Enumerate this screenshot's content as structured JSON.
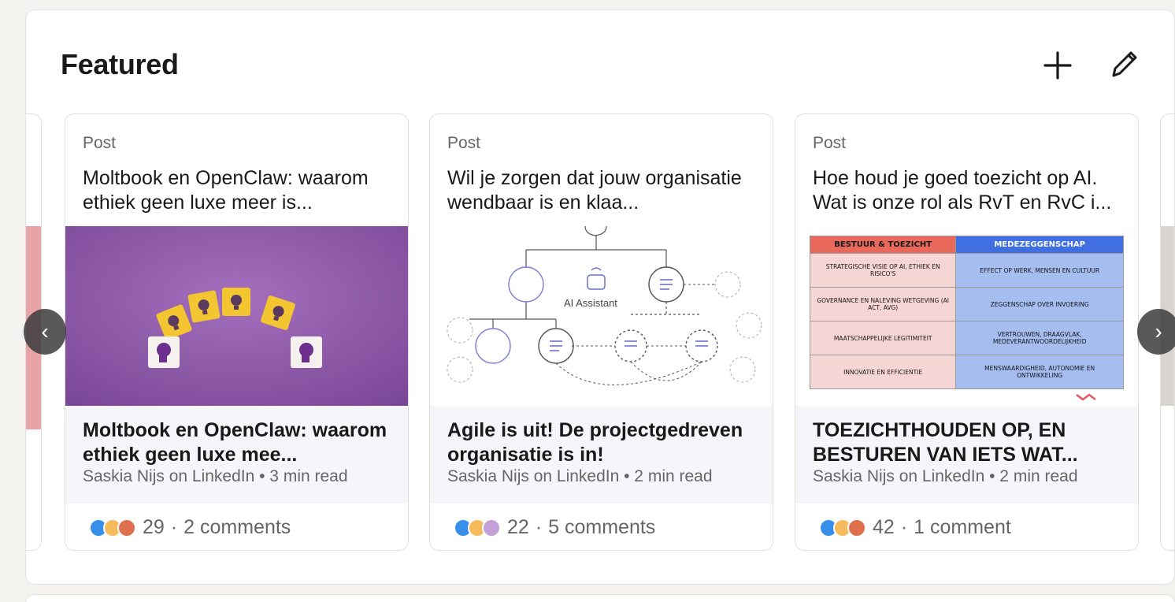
{
  "section": {
    "title": "Featured"
  },
  "header_actions": {
    "add_icon": "plus-icon",
    "edit_icon": "pencil-icon"
  },
  "nav": {
    "prev_label": "‹",
    "next_label": "›"
  },
  "cards": [
    {
      "type": "Post",
      "text": "Moltbook en OpenClaw: waarom ethiek geen luxe meer is...",
      "image": "lightbulb-blocks-purple",
      "article_title": "Moltbook en OpenClaw: waarom ethiek geen luxe mee...",
      "article_sub": "Saskia Nijs on LinkedIn • 3 min read",
      "reactions": [
        "like",
        "idea",
        "love"
      ],
      "count": "29",
      "comments": "2 comments"
    },
    {
      "type": "Post",
      "text": "Wil je zorgen dat jouw organisatie wendbaar is en klaa...",
      "image": "ai-assistant-network",
      "image_label": "AI Assistant",
      "article_title": "Agile is uit! De projectgedreven organisatie is in!",
      "article_sub": "Saskia Nijs on LinkedIn • 2 min read",
      "reactions": [
        "like",
        "idea",
        "support"
      ],
      "count": "22",
      "comments": "5 comments"
    },
    {
      "type": "Post",
      "text": "Hoe houd je goed toezicht op AI. Wat is onze rol als RvT en RvC i...",
      "image": "governance-table",
      "table": {
        "headers": [
          "BESTUUR & TOEZICHT",
          "MEDEZEGGENSCHAP"
        ],
        "rows": [
          [
            "STRATEGISCHE VISIE OP AI, ETHIEK EN RISICO'S",
            "EFFECT OP WERK, MENSEN EN CULTUUR"
          ],
          [
            "GOVERNANCE EN NALEVING WETGEVING (AI ACT, AVG)",
            "ZEGGENSCHAP OVER INVOERING"
          ],
          [
            "MAATSCHAPPELIJKE LEGITIMITEIT",
            "VERTROUWEN, DRAAGVLAK, MEDEVERANTWOORDELIJKHEID"
          ],
          [
            "INNOVATIE EN EFFICIENTIE",
            "MENSWAARDIGHEID, AUTONOMIE EN ONTWIKKELING"
          ]
        ]
      },
      "article_title": "TOEZICHTHOUDEN OP, EN BESTUREN VAN IETS WAT...",
      "article_sub": "Saskia Nijs on LinkedIn • 2 min read",
      "reactions": [
        "like",
        "idea",
        "love"
      ],
      "count": "42",
      "comments": "1 comment"
    }
  ],
  "colors": {
    "purple_bg": "#8e5ba8",
    "table_header_left": "#e8695c",
    "table_header_right": "#3f6fe0",
    "table_left": "#f6d5d5",
    "table_right": "#a6bdf0"
  }
}
